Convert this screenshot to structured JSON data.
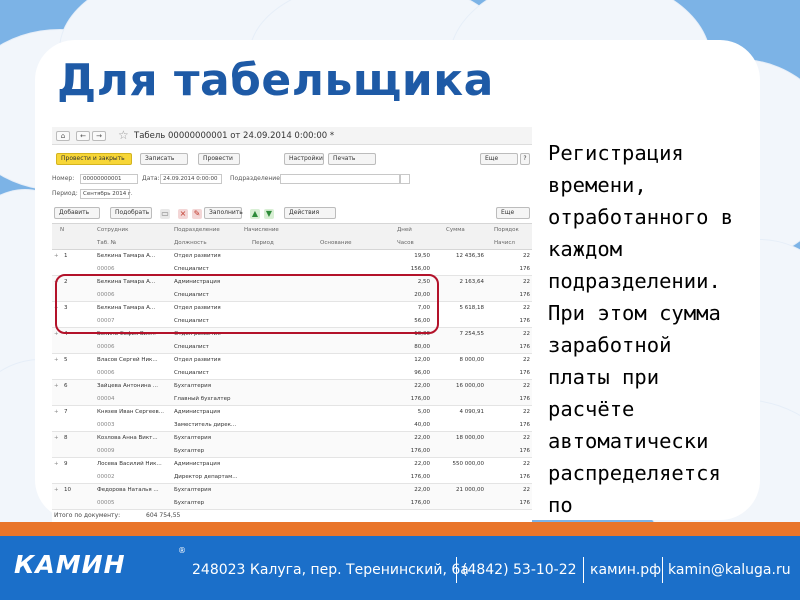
{
  "slide": {
    "title": "Для табельщика",
    "description": "Регистрация\nвремени,\nотработанного в\nкаждом\nподразделении.\nПри этом сумма\nзаработной\nплаты при\nрасчёте\nавтоматически\nраспределяется\nпо\nподразделениям"
  },
  "window": {
    "doc_title": "Табель 00000000001 от 24.09.2014 0:00:00 *",
    "nav_home": "⌂",
    "nav_back": "←",
    "nav_forward": "→",
    "buttons": {
      "post_close": "Провести и закрыть",
      "record": "Записать",
      "post": "Провести",
      "settings": "Настройки",
      "print": "Печать",
      "more": "Еще"
    },
    "fields": {
      "number_label": "Номер:",
      "number_value": "00000000001",
      "date_label": "Дата:",
      "date_value": "24.09.2014  0:00:00",
      "department_label": "Подразделение:",
      "period_label": "Период:",
      "period_value": "Сентябрь 2014 г."
    },
    "toolbar": {
      "add": "Добавить",
      "pick": "Подобрать",
      "fill": "Заполнить",
      "actions": "Действия",
      "more": "Еще"
    },
    "columns": {
      "n": "N",
      "employee": "Сотрудник",
      "tab_no": "Таб. №",
      "department": "Подразделение",
      "position": "Должность",
      "accrual": "Начисление",
      "period": "Период",
      "reason": "Основание",
      "days": "Дней",
      "hours": "Часов",
      "sum": "Сумма",
      "order": "Порядок",
      "accrue": "Начисл"
    },
    "rows": [
      {
        "n": "1",
        "employee": "Белкина Тамара А...",
        "tab": "00006",
        "dept": "Отдел развития",
        "pos": "Специалист",
        "days": "19,50",
        "hours": "156,00",
        "sum": "12 436,36",
        "ord": "22",
        "acc": "176"
      },
      {
        "n": "2",
        "employee": "Белкина Тамара А...",
        "tab": "00006",
        "dept": "Администрация",
        "pos": "Специалист",
        "days": "2,50",
        "hours": "20,00",
        "sum": "2 163,64",
        "ord": "22",
        "acc": "176"
      },
      {
        "n": "3",
        "employee": "Белкина Тамара А...",
        "tab": "00007",
        "dept": "Отдел развития",
        "pos": "Специалист",
        "days": "7,00",
        "hours": "56,00",
        "sum": "5 618,18",
        "ord": "22",
        "acc": "176"
      },
      {
        "n": "4",
        "employee": "Бекина Софья Вик...",
        "tab": "00006",
        "dept": "Отдел развития",
        "pos": "Специалист",
        "days": "10,00",
        "hours": "80,00",
        "sum": "7 254,55",
        "ord": "22",
        "acc": "176"
      },
      {
        "n": "5",
        "employee": "Власов Сергей Ник...",
        "tab": "00006",
        "dept": "Отдел развития",
        "pos": "Специалист",
        "days": "12,00",
        "hours": "96,00",
        "sum": "8 000,00",
        "ord": "22",
        "acc": "176"
      },
      {
        "n": "6",
        "employee": "Зайцева Антонина ...",
        "tab": "00004",
        "dept": "Бухгалтерия",
        "pos": "Главный бухгалтер",
        "days": "22,00",
        "hours": "176,00",
        "sum": "16 000,00",
        "ord": "22",
        "acc": "176"
      },
      {
        "n": "7",
        "employee": "Князев Иван Сергеев...",
        "tab": "00003",
        "dept": "Администрация",
        "pos": "Заместитель дирек...",
        "days": "5,00",
        "hours": "40,00",
        "sum": "4 090,91",
        "ord": "22",
        "acc": "176"
      },
      {
        "n": "8",
        "employee": "Козлова Анна Викт...",
        "tab": "00009",
        "dept": "Бухгалтерия",
        "pos": "Бухгалтер",
        "days": "22,00",
        "hours": "176,00",
        "sum": "18 000,00",
        "ord": "22",
        "acc": "176"
      },
      {
        "n": "9",
        "employee": "Лосева Василий Ник...",
        "tab": "00002",
        "dept": "Администрация",
        "pos": "Директор департам...",
        "days": "22,00",
        "hours": "176,00",
        "sum": "550 000,00",
        "ord": "22",
        "acc": "176"
      },
      {
        "n": "10",
        "employee": "Федорова Наталья ...",
        "tab": "00005",
        "dept": "Бухгалтерия",
        "pos": "Бухгалтер",
        "days": "22,00",
        "hours": "176,00",
        "sum": "21 000,00",
        "ord": "22",
        "acc": "176"
      }
    ],
    "total_label": "Итого по документу:",
    "total_value": "604 754,55"
  },
  "footer": {
    "logo": "КАМИН",
    "reg": "®",
    "address": "248023 Калуга, пер. Теренинский, 6а",
    "phone": "(4842) 53-10-22",
    "site": "камин.рф",
    "email": "kamin@kaluga.ru"
  },
  "colors": {
    "title": "#1e5aa6",
    "footer_bg": "#1b6fc9",
    "footer_stripe": "#e9752a",
    "highlight": "#b3122a",
    "primary_button": "#f7d637"
  }
}
